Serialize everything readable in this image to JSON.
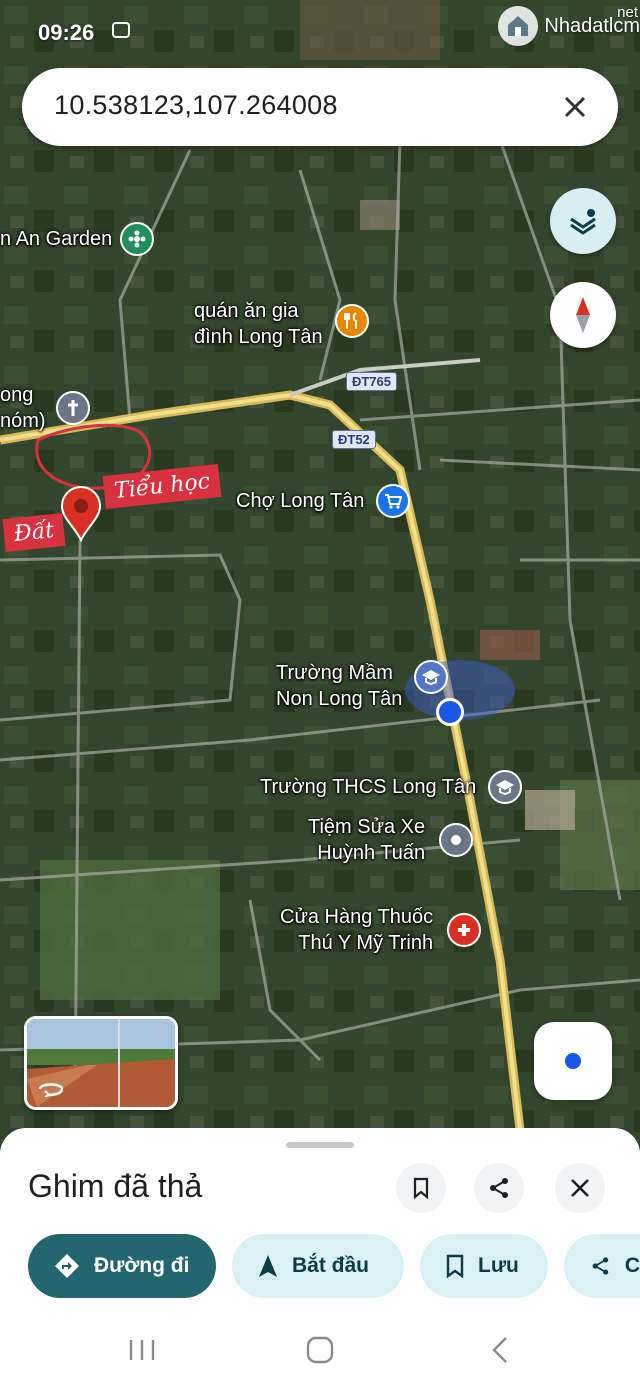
{
  "status": {
    "time": "09:26"
  },
  "watermark": {
    "text": "Nhadatlcm",
    "suffix": "net"
  },
  "search": {
    "query": "10.538123,107.264008"
  },
  "map_labels": {
    "garden": "n An Garden",
    "restaurant": "quán ăn gia\nđình Long Tân",
    "church": "ong\nnóm)",
    "market": "Chợ Long Tân",
    "kindergarten": "Trường Mầm\nNon Long Tân",
    "middle_school": "Trường THCS Long Tân",
    "repair": "Tiệm Sửa Xe\nHuỳnh Tuấn",
    "pharmacy": "Cửa Hàng Thuốc\nThú Y Mỹ Trinh"
  },
  "road_shields": {
    "dt765": "ĐT765",
    "dt52": "ĐT52"
  },
  "annotations": {
    "primary_school": "Tiểu học",
    "land": "Đất"
  },
  "sheet": {
    "title": "Ghim đã thả",
    "directions_label": "Đường đi",
    "start_label": "Bắt đầu",
    "save_label": "Lưu",
    "share_label_partial": "C"
  },
  "icons": [
    "close-icon",
    "layers-icon",
    "compass-icon",
    "flower-icon",
    "restaurant-icon",
    "church-icon",
    "shopping-cart-icon",
    "school-icon",
    "pin-icon",
    "pharmacy-icon",
    "my-location-icon",
    "bookmark-icon",
    "share-icon",
    "directions-icon",
    "navigation-icon",
    "recent-apps-icon",
    "home-icon",
    "back-icon"
  ],
  "colors": {
    "accent": "#24666f",
    "chip": "#d9f0f4",
    "pin_red": "#d93025",
    "location_blue": "#1a57e8"
  }
}
